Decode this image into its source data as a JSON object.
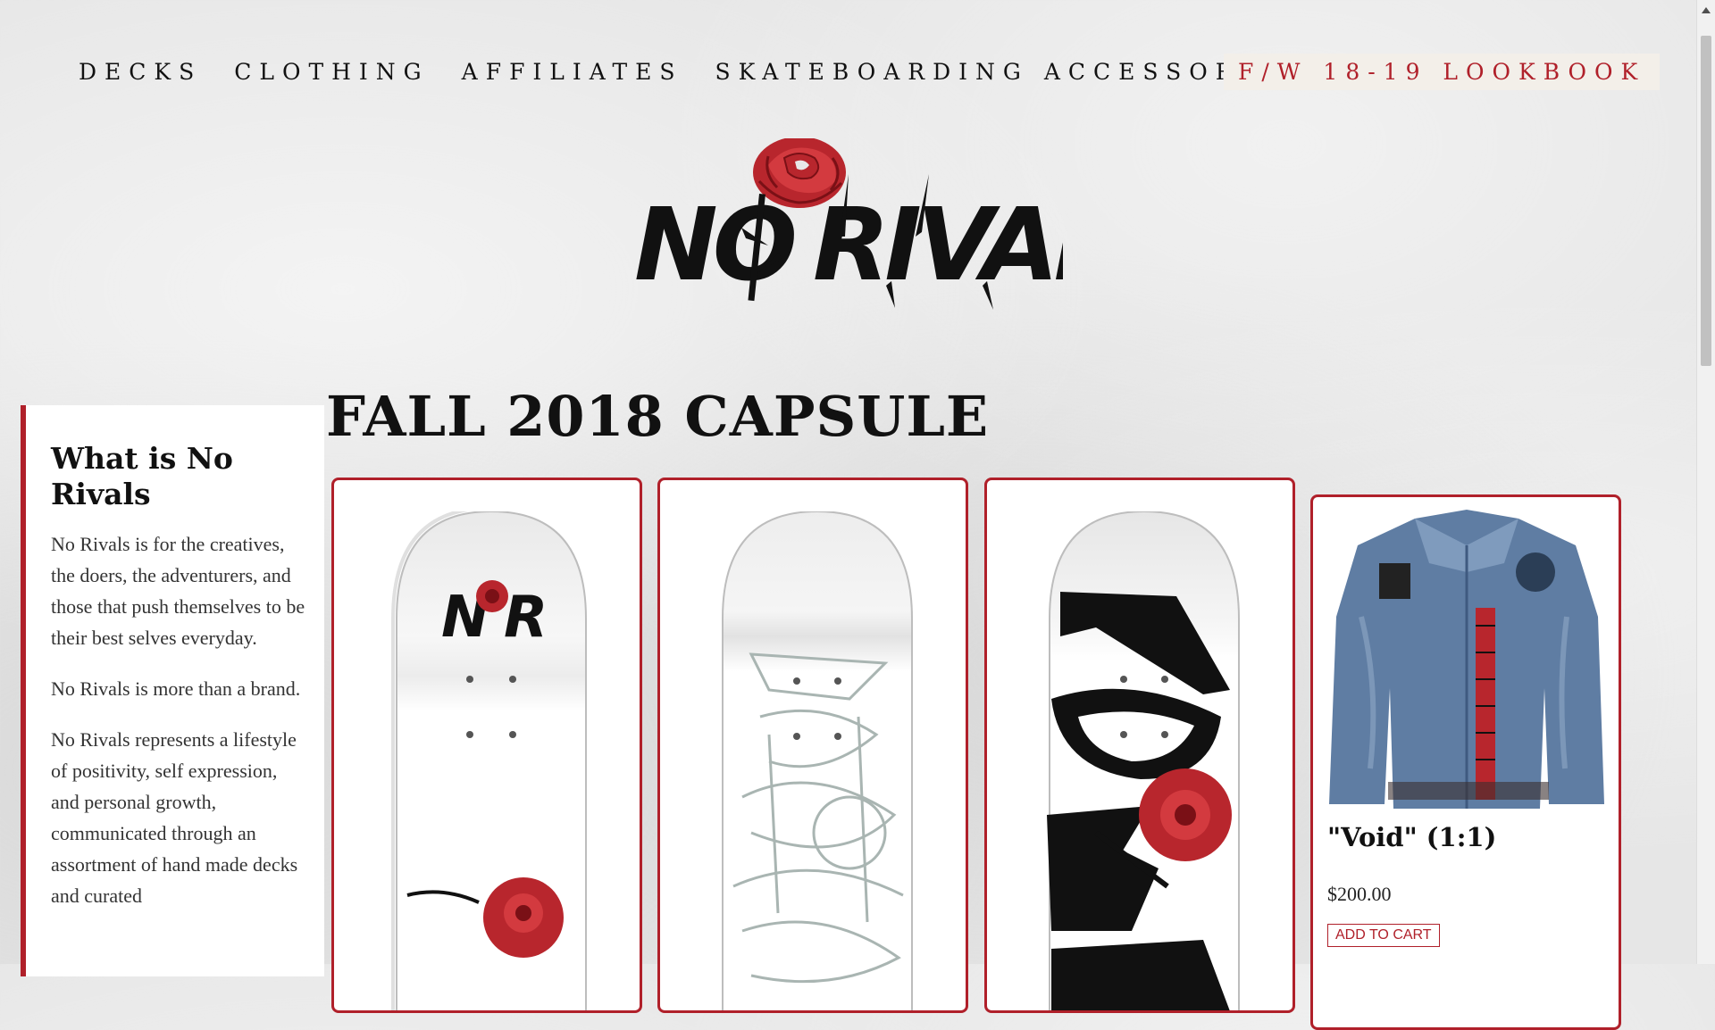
{
  "nav": {
    "items": [
      "DECKS",
      "CLOTHING",
      "AFFILIATES",
      "SKATEBOARDING ACCESSORIES"
    ],
    "lookbook": "F/W 18-19 LOOKBOOK"
  },
  "brand": {
    "logo_text": "NORIVALS",
    "accent_color": "#b0202a"
  },
  "sidebar": {
    "title": "What is No Rivals",
    "paragraphs": [
      "No Rivals is for the creatives, the doers, the adventurers, and those that push themselves to be their best selves everyday.",
      "No Rivals is more than a brand.",
      "No Rivals represents a lifestyle of positivity, self expression, and personal growth, communicated through an assortment of hand made decks and curated"
    ]
  },
  "main": {
    "title": "FALL 2018 CAPSULE",
    "products": [
      {
        "kind": "deck",
        "icon": "deck-nr-rose-white"
      },
      {
        "kind": "deck",
        "icon": "deck-outline-gray"
      },
      {
        "kind": "deck",
        "icon": "deck-norivals-black-red"
      },
      {
        "kind": "jacket",
        "icon": "denim-jacket",
        "title": "\"Void\" (1:1)",
        "price": "$200.00",
        "button": "ADD TO CART"
      }
    ]
  }
}
